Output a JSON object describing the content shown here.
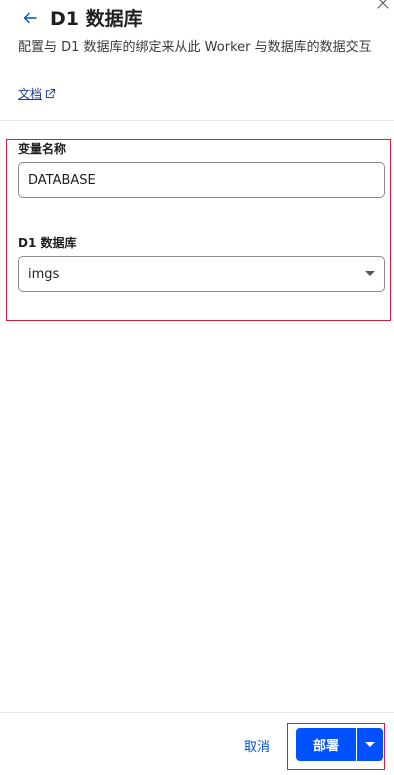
{
  "header": {
    "title": "D1 数据库",
    "description": "配置与 D1 数据库的绑定来从此 Worker 与数据库的数据交互",
    "doc_link": "文档"
  },
  "form": {
    "variable_name_label": "变量名称",
    "variable_name_value": "DATABASE",
    "database_label": "D1 数据库",
    "database_selected": "imgs"
  },
  "footer": {
    "cancel_label": "取消",
    "deploy_label": "部署"
  },
  "colors": {
    "accent": "#0051ff",
    "link": "#0051c3",
    "highlight_border": "#d21f3c"
  }
}
